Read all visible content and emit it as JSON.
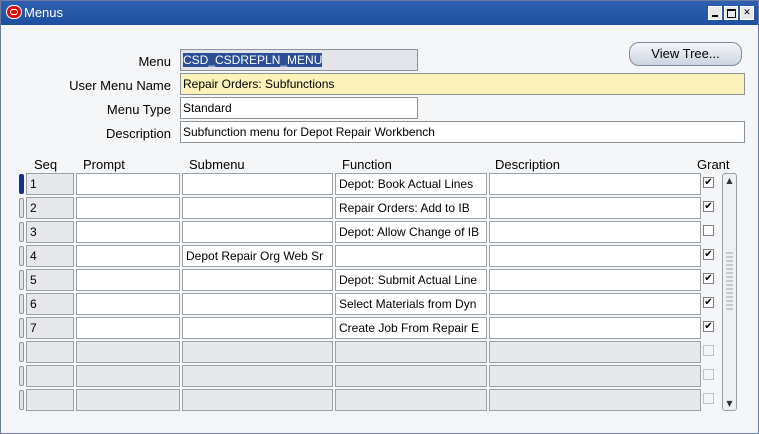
{
  "window": {
    "title": "Menus"
  },
  "header": {
    "menu_label": "Menu",
    "menu_value": "CSD_CSDREPLN_MENU",
    "user_menu_name_label": "User Menu Name",
    "user_menu_name_value": "Repair Orders: Subfunctions",
    "menu_type_label": "Menu Type",
    "menu_type_value": "Standard",
    "description_label": "Description",
    "description_value": "Subfunction menu for Depot Repair Workbench",
    "view_tree_label": "View Tree..."
  },
  "table": {
    "columns": [
      "Seq",
      "Prompt",
      "Submenu",
      "Function",
      "Description",
      "Grant"
    ],
    "rows": [
      {
        "seq": "1",
        "prompt": "",
        "submenu": "",
        "function": "Depot: Book Actual Lines",
        "description": "",
        "grant": true
      },
      {
        "seq": "2",
        "prompt": "",
        "submenu": "",
        "function": "Repair Orders: Add to IB",
        "description": "",
        "grant": true
      },
      {
        "seq": "3",
        "prompt": "",
        "submenu": "",
        "function": "Depot: Allow Change of IB",
        "description": "",
        "grant": false
      },
      {
        "seq": "4",
        "prompt": "",
        "submenu": "Depot Repair Org Web Sr",
        "function": "",
        "description": "",
        "grant": true
      },
      {
        "seq": "5",
        "prompt": "",
        "submenu": "",
        "function": "Depot: Submit Actual Line",
        "description": "",
        "grant": true
      },
      {
        "seq": "6",
        "prompt": "",
        "submenu": "",
        "function": "Select Materials from Dyn",
        "description": "",
        "grant": true
      },
      {
        "seq": "7",
        "prompt": "",
        "submenu": "",
        "function": "Create Job From Repair E",
        "description": "",
        "grant": true
      },
      {
        "seq": "",
        "prompt": "",
        "submenu": "",
        "function": "",
        "description": "",
        "grant": false
      },
      {
        "seq": "",
        "prompt": "",
        "submenu": "",
        "function": "",
        "description": "",
        "grant": false
      },
      {
        "seq": "",
        "prompt": "",
        "submenu": "",
        "function": "",
        "description": "",
        "grant": false
      }
    ]
  },
  "colors": {
    "title_bar": "#1f4f9f",
    "required_field": "#fbf3b9",
    "selection": "#2a4f97"
  }
}
